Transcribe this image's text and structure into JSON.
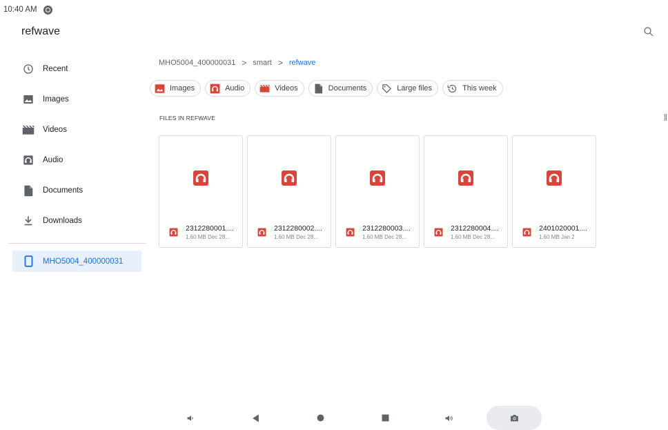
{
  "status_bar": {
    "time": "10:40 AM",
    "notification_icon": "app-notification-icon"
  },
  "header": {
    "title": "refwave",
    "search_icon": "search-icon"
  },
  "sidebar": {
    "items": [
      {
        "label": "Recent",
        "icon": "clock-icon"
      },
      {
        "label": "Images",
        "icon": "image-icon"
      },
      {
        "label": "Videos",
        "icon": "video-icon"
      },
      {
        "label": "Audio",
        "icon": "audio-icon"
      },
      {
        "label": "Documents",
        "icon": "document-icon"
      },
      {
        "label": "Downloads",
        "icon": "download-icon"
      }
    ],
    "device": {
      "label": "MHO5004_400000031",
      "icon": "tablet-icon",
      "selected": true
    }
  },
  "breadcrumb": {
    "items": [
      "MHO5004_400000031",
      "smart",
      "refwave"
    ],
    "separator": ">"
  },
  "chips": [
    {
      "label": "Images",
      "icon": "image-icon"
    },
    {
      "label": "Audio",
      "icon": "audio-icon"
    },
    {
      "label": "Videos",
      "icon": "video-icon"
    },
    {
      "label": "Documents",
      "icon": "document-icon"
    },
    {
      "label": "Large files",
      "icon": "tag-icon"
    },
    {
      "label": "This week",
      "icon": "history-icon"
    }
  ],
  "section": {
    "label": "FILES IN REFWAVE"
  },
  "files": [
    {
      "name": "2312280001....",
      "info": "1.60 MB Dec 28..."
    },
    {
      "name": "2312280002....",
      "info": "1.60 MB Dec 28..."
    },
    {
      "name": "2312280003....",
      "info": "1.60 MB Dec 28..."
    },
    {
      "name": "2312280004....",
      "info": "1.60 MB Dec 28..."
    },
    {
      "name": "2401020001....",
      "info": "1.60 MB Jan 2"
    }
  ],
  "nav_bar": {
    "buttons": [
      "volume-down-icon",
      "back-icon",
      "home-icon",
      "recents-icon",
      "volume-up-icon",
      "screenshot-icon"
    ]
  },
  "colors": {
    "accent": "#1a73e8",
    "file_icon_red": "#db4437",
    "selected_bg": "#e8f0fe",
    "icon_gray": "#5f6368"
  }
}
